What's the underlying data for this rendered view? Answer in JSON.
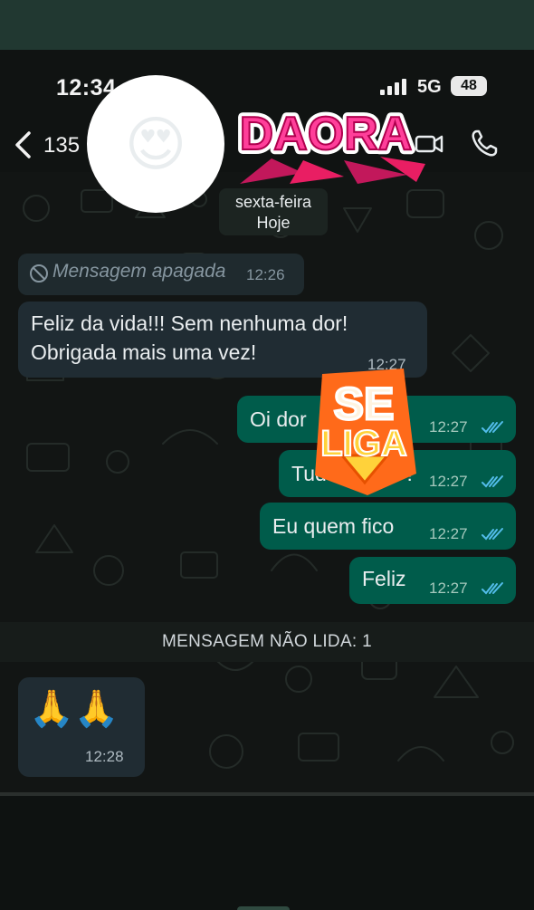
{
  "status_bar": {
    "time": "12:34",
    "network": "5G",
    "battery": "48"
  },
  "header": {
    "contact": "135",
    "sticker_emoji": "😍",
    "daora_sticker": "DAORA",
    "icons": [
      "back-chevron-icon",
      "video-call-icon",
      "voice-call-icon"
    ]
  },
  "date_chip": {
    "weekday": "sexta-feira",
    "today": "Hoje"
  },
  "messages": [
    {
      "type": "deleted",
      "text": "Mensagem apagada",
      "time": "12:26"
    },
    {
      "type": "incoming",
      "lines": [
        "Feliz da vida!!! Sem nenhuma dor!",
        "Obrigada mais uma vez!"
      ],
      "time": "12:27"
    },
    {
      "type": "outgoing",
      "text": "Oi dor",
      "time": "12:27"
    },
    {
      "type": "outgoing",
      "text": "Tud",
      "text_tail": "m !",
      "time": "12:27"
    },
    {
      "type": "outgoing",
      "text": "Eu quem fico",
      "time": "12:27"
    },
    {
      "type": "outgoing",
      "text": "Feliz",
      "time": "12:27"
    }
  ],
  "unread_banner": "MENSAGEM NÃO LIDA: 1",
  "last_message": {
    "emoji": "🙏🙏",
    "time": "12:28"
  },
  "overlay_sticker": {
    "line1": "SE",
    "line2": "LIGA"
  },
  "colors": {
    "incoming_bubble": "#202c33",
    "outgoing_bubble": "#005c4b",
    "read_ticks": "#53bdeb",
    "daora_pink": "#ff4fa3",
    "seliga_orange": "#ff6a1a"
  }
}
